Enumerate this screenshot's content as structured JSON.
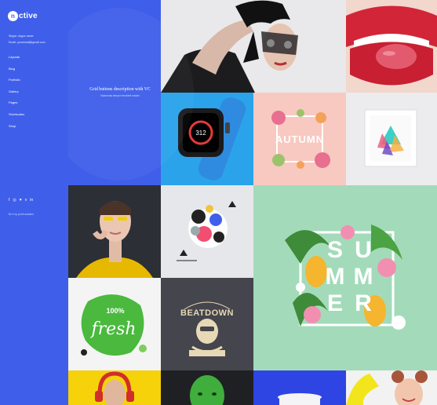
{
  "brand": {
    "logo_mark": "n",
    "name": "ctive"
  },
  "contact": {
    "phone": "Skype: skype-name",
    "email": "Email: youremail@gmail.com"
  },
  "nav": [
    "Layouts",
    "Blog",
    "Portfolio",
    "Gallery",
    "Pages",
    "Shortcodes",
    "Shop"
  ],
  "social": {
    "facebook": "f",
    "instagram": "◎",
    "twitter": "♥",
    "vimeo": "v",
    "linkedin": "in"
  },
  "credit": "Be ♥ by youth asadam",
  "hero": {
    "title": "Grid buttons description with VC",
    "subtitle": "Maecenas tempor hendrerit mauris"
  },
  "tiles": {
    "watch_time": "312",
    "autumn_text": "AUTUMN",
    "fresh_text": "fresh",
    "fresh_num": "100%",
    "beatdown_text": "BEATDOWN",
    "summer_letters": [
      "S",
      "U",
      "M",
      "M",
      "E",
      "R"
    ]
  },
  "colors": {
    "sidebar": "#3f5fea",
    "summer_bg": "#a3dbba",
    "autumn_bg": "#f7c9c0",
    "watch_bg": "#2aa3ea"
  }
}
